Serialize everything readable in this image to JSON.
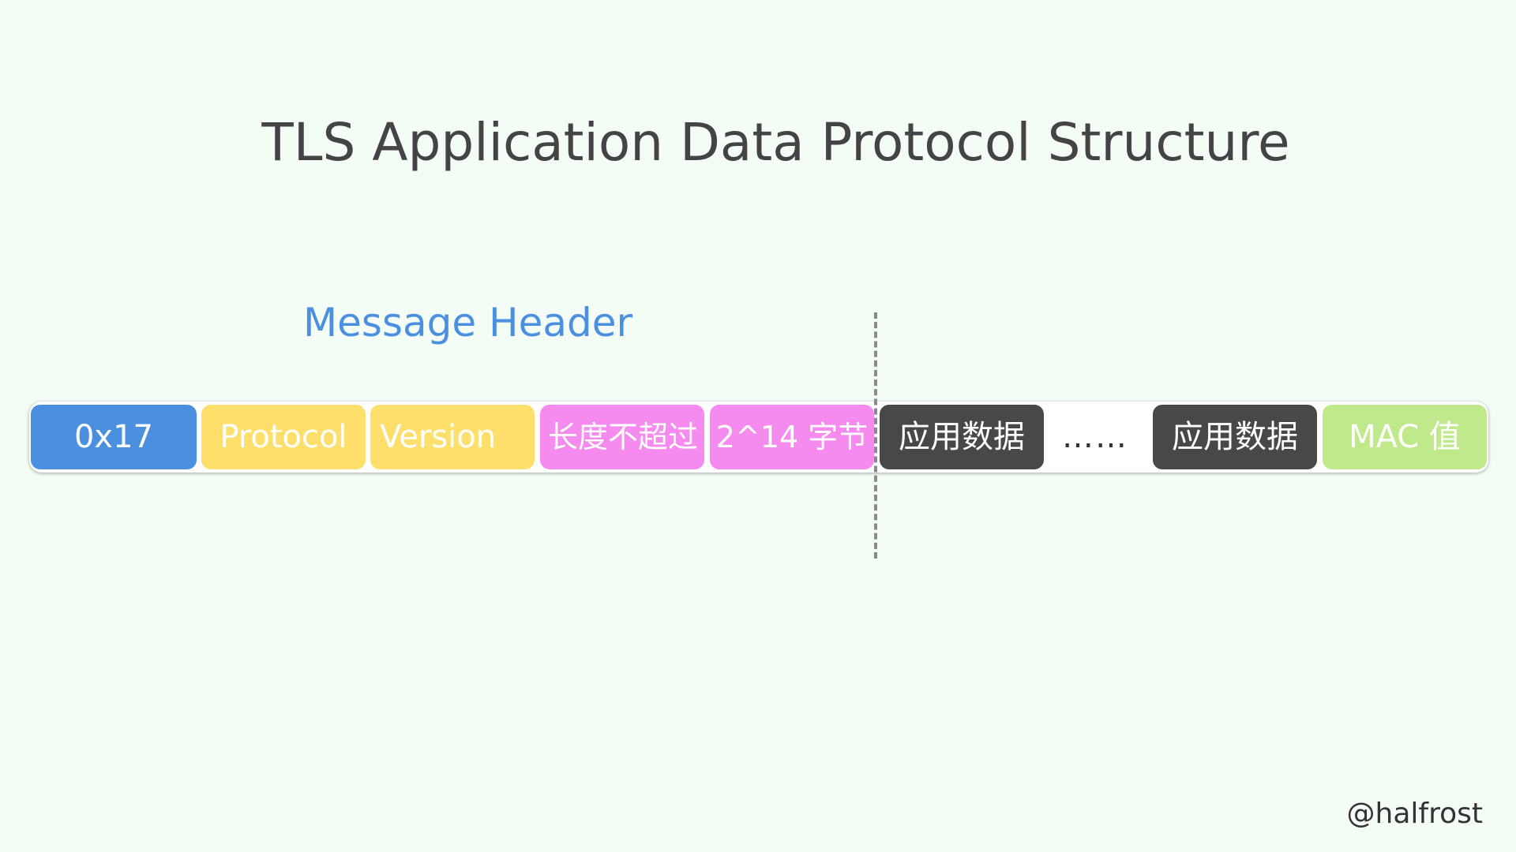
{
  "title": "TLS Application Data Protocol Structure",
  "message_header": {
    "label": "Message Header",
    "color": "#4a8fe0"
  },
  "fields": [
    {
      "label": "0x17",
      "bg": "#4a8fe0",
      "fg": "#ffffff"
    },
    {
      "label": "Protocol",
      "bg": "#ffdf6b",
      "fg": "#ffffff"
    },
    {
      "label": "Version",
      "bg": "#ffdf6b",
      "fg": "#ffffff"
    },
    {
      "label": "长度不超过",
      "bg": "#f58bef",
      "fg": "#ffffff"
    },
    {
      "label": "2^14 字节",
      "bg": "#f58bef",
      "fg": "#ffffff"
    },
    {
      "label": "应用数据",
      "bg": "#484848",
      "fg": "#ffffff"
    },
    {
      "label": "……",
      "bg": "#ffffff",
      "fg": "#333333"
    },
    {
      "label": "应用数据",
      "bg": "#484848",
      "fg": "#ffffff"
    },
    {
      "label": "MAC 值",
      "bg": "#bfe98a",
      "fg": "#ffffff"
    }
  ],
  "credit": "@halfrost"
}
